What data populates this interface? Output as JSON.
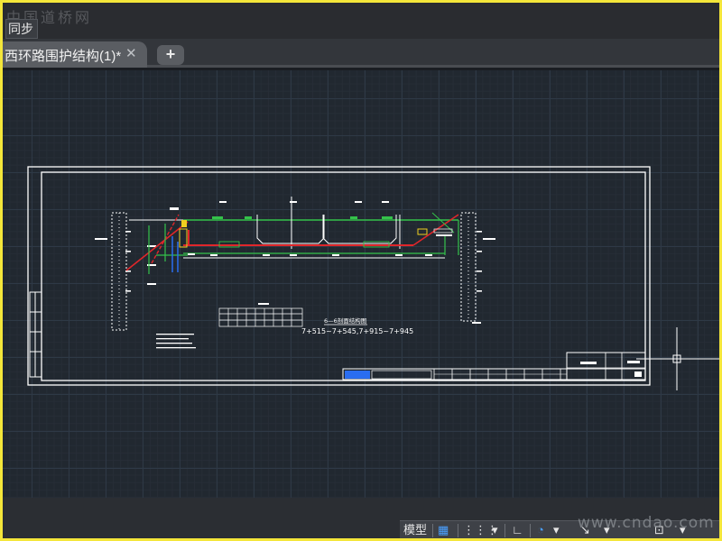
{
  "watermark": {
    "top": "中国道桥网",
    "bottom": "www.cndao.com"
  },
  "titlebar": {
    "sync_label": "同步"
  },
  "tabs": [
    {
      "label": "西环路围护结构(1)*",
      "active": true
    }
  ],
  "tab_close_symbol": "✕",
  "new_tab_symbol": "+",
  "drawing": {
    "section_title": "6—6剖面结构图",
    "stations": "7+515~7+545,7+915~7+945"
  },
  "statusbar": {
    "model_label": "模型",
    "items": [
      "grid-icon",
      "snap-icon",
      "ortho-icon",
      "polar-icon",
      "osnap-icon",
      "scale-icon"
    ]
  },
  "colors": {
    "frame": "#f4e63a",
    "canvas_bg": "#212830",
    "drawing_white": "#ffffff",
    "drawing_red": "#e0262a",
    "drawing_green": "#34c24a",
    "drawing_blue": "#2a6df0",
    "drawing_yellow": "#f0d020"
  }
}
